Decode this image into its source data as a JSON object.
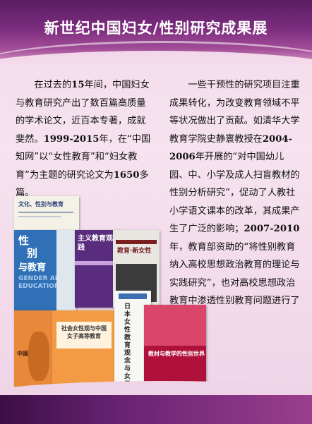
{
  "slide": {
    "title": "新世纪中国妇女/性别研究成果展",
    "left_paragraph": {
      "p1": "在过去的",
      "b1": "15",
      "p2": "年间，中国妇女与教育研究产出了数百篇高质量的学术论文，近百本专著，成就斐然。",
      "b2": "1999-2015",
      "p3": "年，在“中国知网”以“女性教育”和“妇女教育”为主题的研究论文为",
      "b3": "1650",
      "p4": "多篇。"
    },
    "right_paragraph": {
      "p1": "一些干预性的研究项目注重成果转化，为改变教育领域不平等状况做出了贡献。如清华大学教育学院史静寰教授在",
      "b1": "2004-2006",
      "p2": "年开展的“对中国幼儿园、中、小学及成人扫盲教材的性别分析研究”，促动了人教社小学语文课本的改革，其成果产生了广泛的影响；",
      "b2": "2007-2010",
      "p3": "年，教育部资助的“将性别教育纳入高校思想政治教育的理论与实践研究”，也对高校思想政治教育中渗透性别教育问题进行了探索。"
    },
    "books": {
      "b1_title": "文化、性别与教育",
      "b2_title_a": "性",
      "b2_title_b": "别",
      "b2_title_c": "与教育",
      "b2_en": "GENDER AND EDUCATION",
      "b3_title": "主义教育观实践",
      "b4_title": "教育·新女性",
      "b5_title": "中国近代",
      "b6_title": "社会女性观与中国女子高等教育",
      "b7_title": "日本女性教育观念与女子学校",
      "b8_title": "教材与教学的性别世界"
    },
    "colors": {
      "header": "#7d2d7f",
      "footer": "#6a2374",
      "background": "#f3d9ea"
    }
  }
}
